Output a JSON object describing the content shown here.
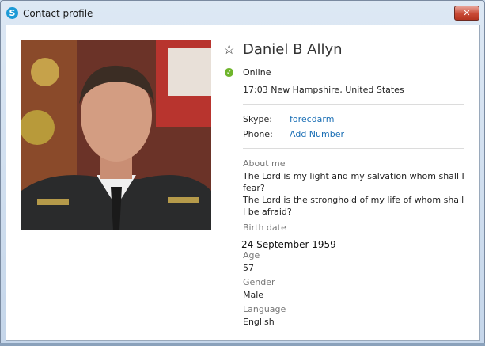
{
  "window": {
    "title": "Contact profile",
    "app_icon_letter": "S"
  },
  "profile": {
    "name": "Daniel B Allyn",
    "status": "Online",
    "local_time": "17:03 New Hampshire, United States",
    "skype_label": "Skype:",
    "skype_value": "forecdarm",
    "phone_label": "Phone:",
    "phone_value": "Add Number",
    "about_label": "About me",
    "about_text": "The Lord is my light and my salvation whom shall I fear?\nThe Lord is the stronghold of my life of whom shall I be afraid?",
    "birth_label": "Birth date",
    "birth_value": "24 September 1959",
    "age_label": "Age",
    "age_value": "57",
    "gender_label": "Gender",
    "gender_value": "Male",
    "language_label": "Language",
    "language_value": "English"
  },
  "colors": {
    "link": "#1b6fb5",
    "online": "#6fb52c",
    "close": "#c94a36"
  },
  "icons": {
    "favorite": "star-outline-icon",
    "status": "online-check-icon",
    "close": "close-icon"
  }
}
